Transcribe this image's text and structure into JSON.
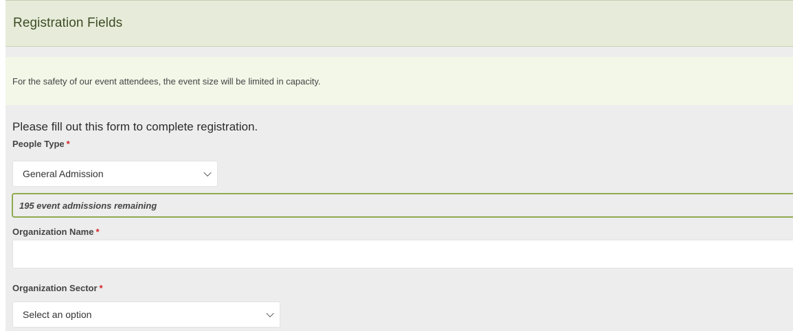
{
  "section": {
    "title": "Registration Fields"
  },
  "notice": {
    "text": "For the safety of our event attendees, the event size will be limited in capacity."
  },
  "form": {
    "intro": "Please fill out this form to complete registration.",
    "required_marker": "*",
    "people_type": {
      "label": "People Type",
      "selected": "General Admission"
    },
    "remaining_text": "195 event admissions remaining",
    "organization_name": {
      "label": "Organization Name",
      "value": "",
      "placeholder": ""
    },
    "organization_sector": {
      "label": "Organization Sector",
      "selected": "Select an option"
    }
  },
  "colors": {
    "header_bg": "#e6ecd9",
    "notice_bg": "#f2f7e8",
    "accent_border": "#8faa51",
    "required": "#d22222"
  },
  "icons": {
    "select_chevron": "chevron-down-icon"
  }
}
